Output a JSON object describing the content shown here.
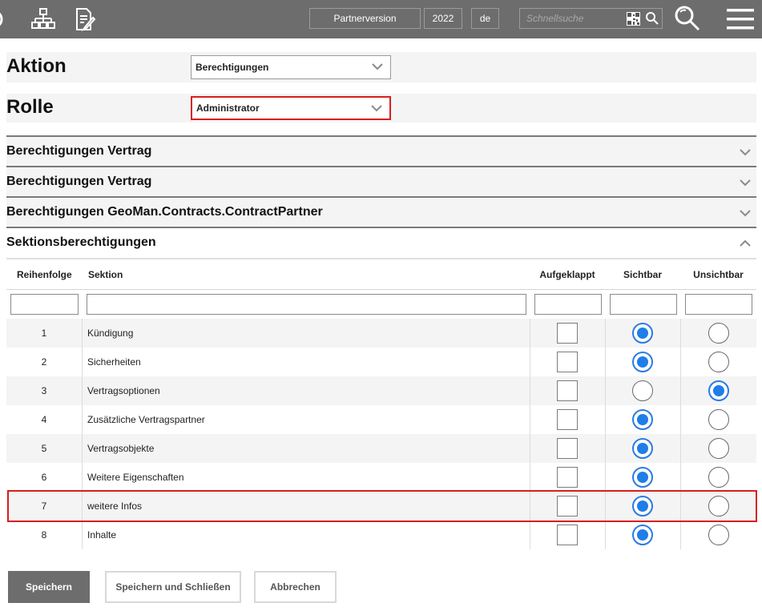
{
  "header": {
    "version_label": "Partnerversion",
    "year": "2022",
    "language": "de",
    "search_placeholder": "Schnellsuche"
  },
  "form": {
    "action_label": "Aktion",
    "action_value": "Berechtigungen",
    "role_label": "Rolle",
    "role_value": "Administrator"
  },
  "accordions": [
    {
      "title": "Berechtigungen Vertrag",
      "open": false
    },
    {
      "title": "Berechtigungen Vertrag",
      "open": false
    },
    {
      "title": "Berechtigungen GeoMan.Contracts.ContractPartner",
      "open": false
    },
    {
      "title": "Sektionsberechtigungen",
      "open": true
    }
  ],
  "table": {
    "columns": [
      "Reihenfolge",
      "Sektion",
      "Aufgeklappt",
      "Sichtbar",
      "Unsichtbar"
    ],
    "rows": [
      {
        "order": "1",
        "section": "Kündigung",
        "expanded": false,
        "visible": true
      },
      {
        "order": "2",
        "section": "Sicherheiten",
        "expanded": false,
        "visible": true
      },
      {
        "order": "3",
        "section": "Vertragsoptionen",
        "expanded": false,
        "visible": false
      },
      {
        "order": "4",
        "section": "Zusätzliche Vertragspartner",
        "expanded": false,
        "visible": true
      },
      {
        "order": "5",
        "section": "Vertragsobjekte",
        "expanded": false,
        "visible": true
      },
      {
        "order": "6",
        "section": "Weitere Eigenschaften",
        "expanded": false,
        "visible": true
      },
      {
        "order": "7",
        "section": "weitere Infos",
        "expanded": false,
        "visible": true
      },
      {
        "order": "8",
        "section": "Inhalte",
        "expanded": false,
        "visible": true
      }
    ]
  },
  "buttons": {
    "save": "Speichern",
    "save_close": "Speichern und Schließen",
    "cancel": "Abbrechen"
  },
  "colors": {
    "topbar": "#6d6d6d",
    "radio_selected": "#1f7ee8",
    "highlight": "#d81e1e"
  }
}
